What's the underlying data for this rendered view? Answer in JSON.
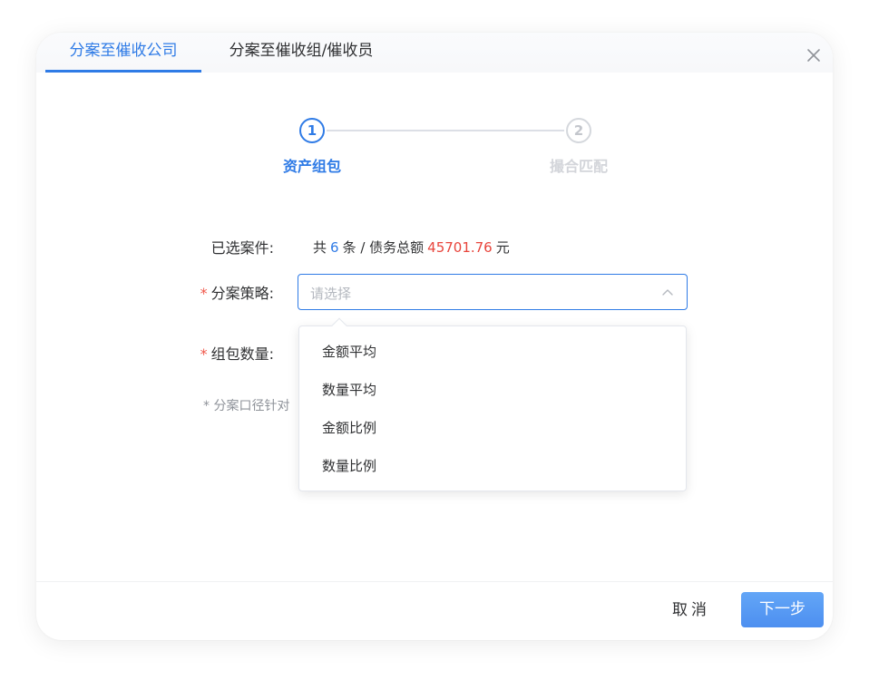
{
  "tabs": [
    {
      "label": "分案至催收公司",
      "active": true
    },
    {
      "label": "分案至催收组/催收员",
      "active": false
    }
  ],
  "steps": [
    {
      "number": "1",
      "title": "资产组包",
      "active": true
    },
    {
      "number": "2",
      "title": "撮合匹配",
      "active": false
    }
  ],
  "form": {
    "selected_label": "已选案件:",
    "summary": {
      "prefix": "共",
      "count": "6",
      "middle": "条 / 债务总额",
      "amount": "45701.76",
      "suffix": "元"
    },
    "strategy": {
      "required_mark": "*",
      "label": "分案策略:",
      "placeholder": "请选择",
      "options": [
        "金额平均",
        "数量平均",
        "金额比例",
        "数量比例"
      ]
    },
    "package_count": {
      "required_mark": "*",
      "label": "组包数量:"
    },
    "note": "* 分案口径针对"
  },
  "footer": {
    "cancel_label": "取消",
    "next_label": "下一步"
  },
  "colors": {
    "accent": "#2f7be6",
    "amount": "#e8453c",
    "required": "#f0574a"
  }
}
